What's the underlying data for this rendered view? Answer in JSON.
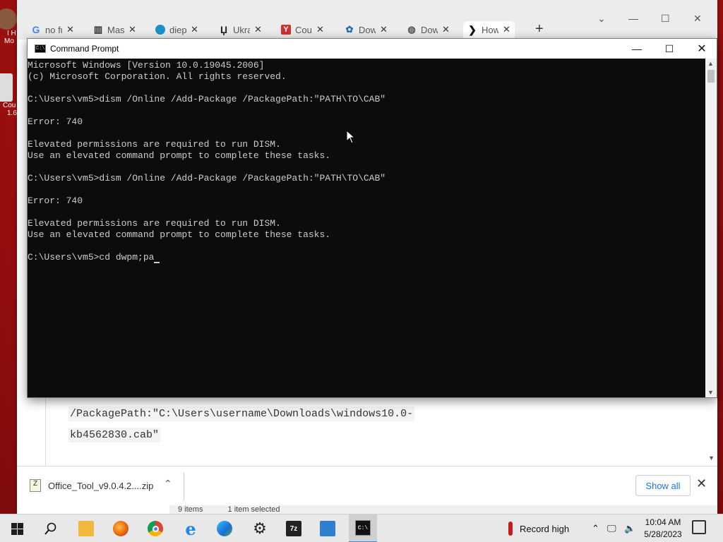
{
  "browser": {
    "tabs": [
      {
        "title": "no fu",
        "icon": "google-icon",
        "color": "#4285f4"
      },
      {
        "title": "Mast",
        "icon": "museum-icon",
        "color": "#333333"
      },
      {
        "title": "diep",
        "icon": "diep-icon",
        "color": "#1e90c8"
      },
      {
        "title": "Ukra",
        "icon": "u-icon",
        "color": "#222222"
      },
      {
        "title": "Cou",
        "icon": "y-icon",
        "color": "#d32f2f"
      },
      {
        "title": "Dow",
        "icon": "gear-icon",
        "color": "#2b6cb0"
      },
      {
        "title": "Dow",
        "icon": "globe-icon",
        "color": "#555555"
      },
      {
        "title": "How",
        "icon": "chevron-icon",
        "color": "#111111"
      }
    ],
    "newtab_label": "+",
    "page": {
      "code_line_1": "/PackagePath:\"C:\\Users\\username\\Downloads\\windows10.0-",
      "code_line_2": "kb4562830.cab\""
    },
    "download": {
      "file": "Office_Tool_v9.0.4.2....zip",
      "show_all": "Show all"
    },
    "status": {
      "items": "9 items",
      "selected": "1 item selected"
    }
  },
  "cmd": {
    "title": "Command Prompt",
    "lines": [
      "Microsoft Windows [Version 10.0.19045.2006]",
      "(c) Microsoft Corporation. All rights reserved.",
      "",
      "C:\\Users\\vm5>dism /Online /Add-Package /PackagePath:\"PATH\\TO\\CAB\"",
      "",
      "Error: 740",
      "",
      "Elevated permissions are required to run DISM.",
      "Use an elevated command prompt to complete these tasks.",
      "",
      "C:\\Users\\vm5>dism /Online /Add-Package /PackagePath:\"PATH\\TO\\CAB\"",
      "",
      "Error: 740",
      "",
      "Elevated permissions are required to run DISM.",
      "Use an elevated command prompt to complete these tasks.",
      ""
    ],
    "current_input": "C:\\Users\\vm5>cd dwpm;pa"
  },
  "desktop": {
    "icon_labels": [
      "I H",
      "Mo",
      "Cou",
      "1.6"
    ]
  },
  "taskbar": {
    "weather": "Record high",
    "time": "10:04 AM",
    "date": "5/28/2023",
    "apps": [
      "search-icon",
      "file-explorer-icon",
      "firefox-icon",
      "chrome-icon",
      "internet-explorer-icon",
      "edge-icon",
      "settings-icon",
      "7zip-icon",
      "remote-desktop-icon",
      "command-prompt-icon"
    ]
  }
}
